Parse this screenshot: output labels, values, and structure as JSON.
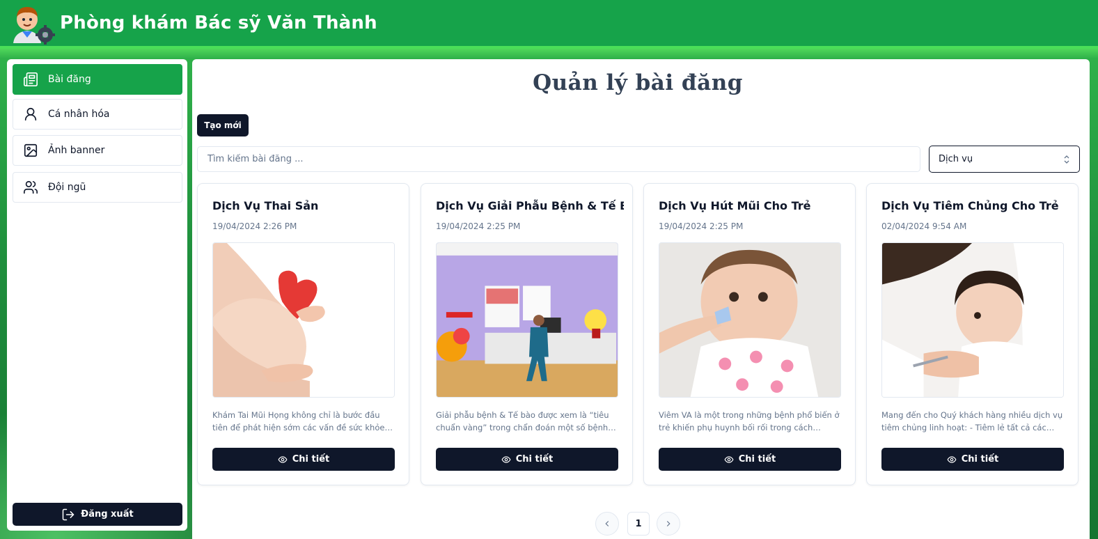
{
  "header": {
    "title": "Phòng khám Bác sỹ Văn Thành"
  },
  "sidebar": {
    "items": [
      {
        "label": "Bài đăng",
        "icon": "newspaper-icon",
        "active": true
      },
      {
        "label": "Cá nhân hóa",
        "icon": "user-icon",
        "active": false
      },
      {
        "label": "Ảnh banner",
        "icon": "image-icon",
        "active": false
      },
      {
        "label": "Đội ngũ",
        "icon": "users-icon",
        "active": false
      }
    ],
    "logout_label": "Đăng xuất"
  },
  "main": {
    "title": "Quản lý bài đăng",
    "create_label": "Tạo mới",
    "search_placeholder": "Tìm kiếm bài đăng ...",
    "category_select": "Dịch vụ",
    "detail_label": "Chi tiết",
    "posts": [
      {
        "title": "Dịch Vụ Thai Sản",
        "date": "19/04/2024 2:26 PM",
        "excerpt": "Khám Tai Mũi Họng không chỉ là bước đầu tiên để phát hiện sớm các vấn đề sức khỏe, mà c..."
      },
      {
        "title": "Dịch Vụ Giải Phẫu Bệnh & Tế Bào",
        "date": "19/04/2024 2:25 PM",
        "excerpt": "Giải phẫu bệnh & Tế bào được xem là “tiêu chuẩn vàng” trong chẩn đoán một số bệnh lý..."
      },
      {
        "title": "Dịch Vụ Hút Mũi Cho Trẻ",
        "date": "19/04/2024 2:25 PM",
        "excerpt": "Viêm VA là một trong những bệnh phổ biến ở trẻ khiến phụ huynh bối rối trong cách chăm..."
      },
      {
        "title": "Dịch Vụ Tiêm Chủng Cho Trẻ",
        "date": "02/04/2024 9:54 AM",
        "excerpt": "Mang đến cho Quý khách hàng nhiều dịch vụ tiêm chủng linh hoạt: - Tiêm lẻ tất cả các loại..."
      }
    ]
  },
  "pagination": {
    "current_page": "1"
  },
  "colors": {
    "brand_green": "#16a34a",
    "dark": "#0f172a",
    "muted": "#64748b"
  }
}
